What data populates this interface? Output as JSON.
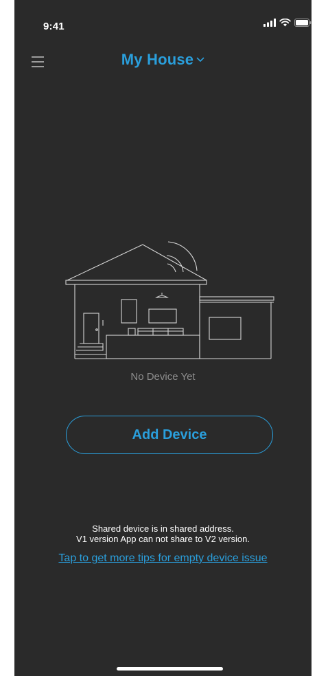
{
  "status_bar": {
    "time": "9:41",
    "icons": [
      "signal-icon",
      "wifi-icon",
      "battery-icon"
    ]
  },
  "header": {
    "title": "My House",
    "menu_icon": "hamburger-menu-icon",
    "dropdown_icon": "chevron-down-icon"
  },
  "empty_state": {
    "illustration": "house-illustration",
    "message": "No Device Yet"
  },
  "actions": {
    "add_device_label": "Add Device"
  },
  "info": {
    "line1": "Shared device is in shared address.",
    "line2": "V1 version App can not share to V2 version."
  },
  "tips": {
    "link_text": "Tap to get more tips for empty device issue"
  },
  "colors": {
    "background": "#2a2a2a",
    "accent": "#2a9fdc",
    "muted_text": "#8e8e8e",
    "illustration_stroke": "#d6d6d6"
  }
}
